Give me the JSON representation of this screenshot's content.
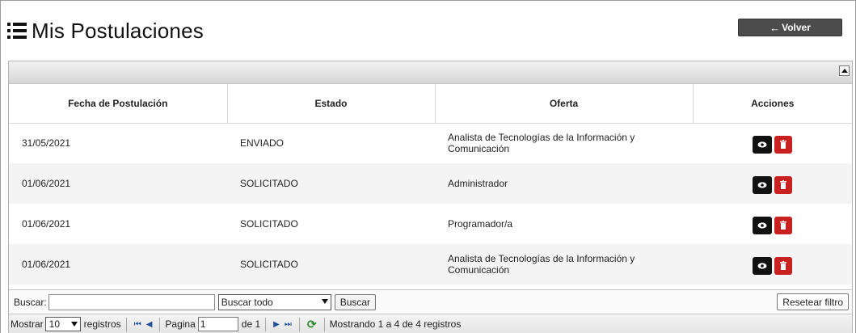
{
  "header": {
    "title": "Mis Postulaciones"
  },
  "back_button": {
    "label": "Volver"
  },
  "table": {
    "columns": [
      "Fecha de Postulación",
      "Estado",
      "Oferta",
      "Acciones"
    ],
    "rows": [
      {
        "fecha": "31/05/2021",
        "estado": "ENVIADO",
        "oferta": "Analista de Tecnologías de la Información y Comunicación"
      },
      {
        "fecha": "01/06/2021",
        "estado": "SOLICITADO",
        "oferta": "Administrador"
      },
      {
        "fecha": "01/06/2021",
        "estado": "SOLICITADO",
        "oferta": "Programador/a"
      },
      {
        "fecha": "01/06/2021",
        "estado": "SOLICITADO",
        "oferta": "Analista de Tecnologías de la Información y Comunicación"
      }
    ]
  },
  "search": {
    "label": "Buscar:",
    "value": "",
    "scope_selected": "Buscar todo",
    "button_label": "Buscar",
    "reset_label": "Resetear filtro"
  },
  "pager": {
    "show_label": "Mostrar",
    "rows_per_page": "10",
    "records_label": "registros",
    "page_label": "Pagina",
    "page_value": "1",
    "of_label": "de 1",
    "info": "Mostrando 1 a 4 de 4 registros"
  },
  "colors": {
    "view_button": "#111111",
    "delete_button": "#c8211f",
    "back_button": "#4c4c4c"
  },
  "icons": {
    "title": "list-icon",
    "view": "eye-icon",
    "delete": "trash-icon",
    "refresh": "refresh-icon"
  }
}
